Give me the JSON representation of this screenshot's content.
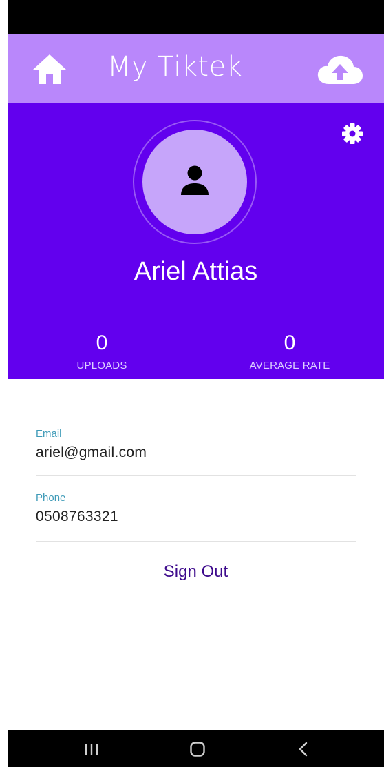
{
  "app_bar": {
    "title": "My Tiktek",
    "background": "#b987fb",
    "left_icon": "home-icon",
    "right_icon": "cloud-upload-icon"
  },
  "profile": {
    "name": "Ariel Attias",
    "header_color": "#6200ee",
    "avatar_icon": "person-icon",
    "settings_icon": "gear-icon",
    "stats": [
      {
        "value": "0",
        "label": "UPLOADS"
      },
      {
        "value": "0",
        "label": "AVERAGE RATE"
      }
    ]
  },
  "details": {
    "email": {
      "label": "Email",
      "value": "ariel@gmail.com"
    },
    "phone": {
      "label": "Phone",
      "value": "0508763321"
    }
  },
  "actions": {
    "sign_out_label": "Sign Out"
  },
  "system_nav": {
    "buttons": [
      "recent-apps-icon",
      "home-nav-icon",
      "back-icon"
    ]
  }
}
